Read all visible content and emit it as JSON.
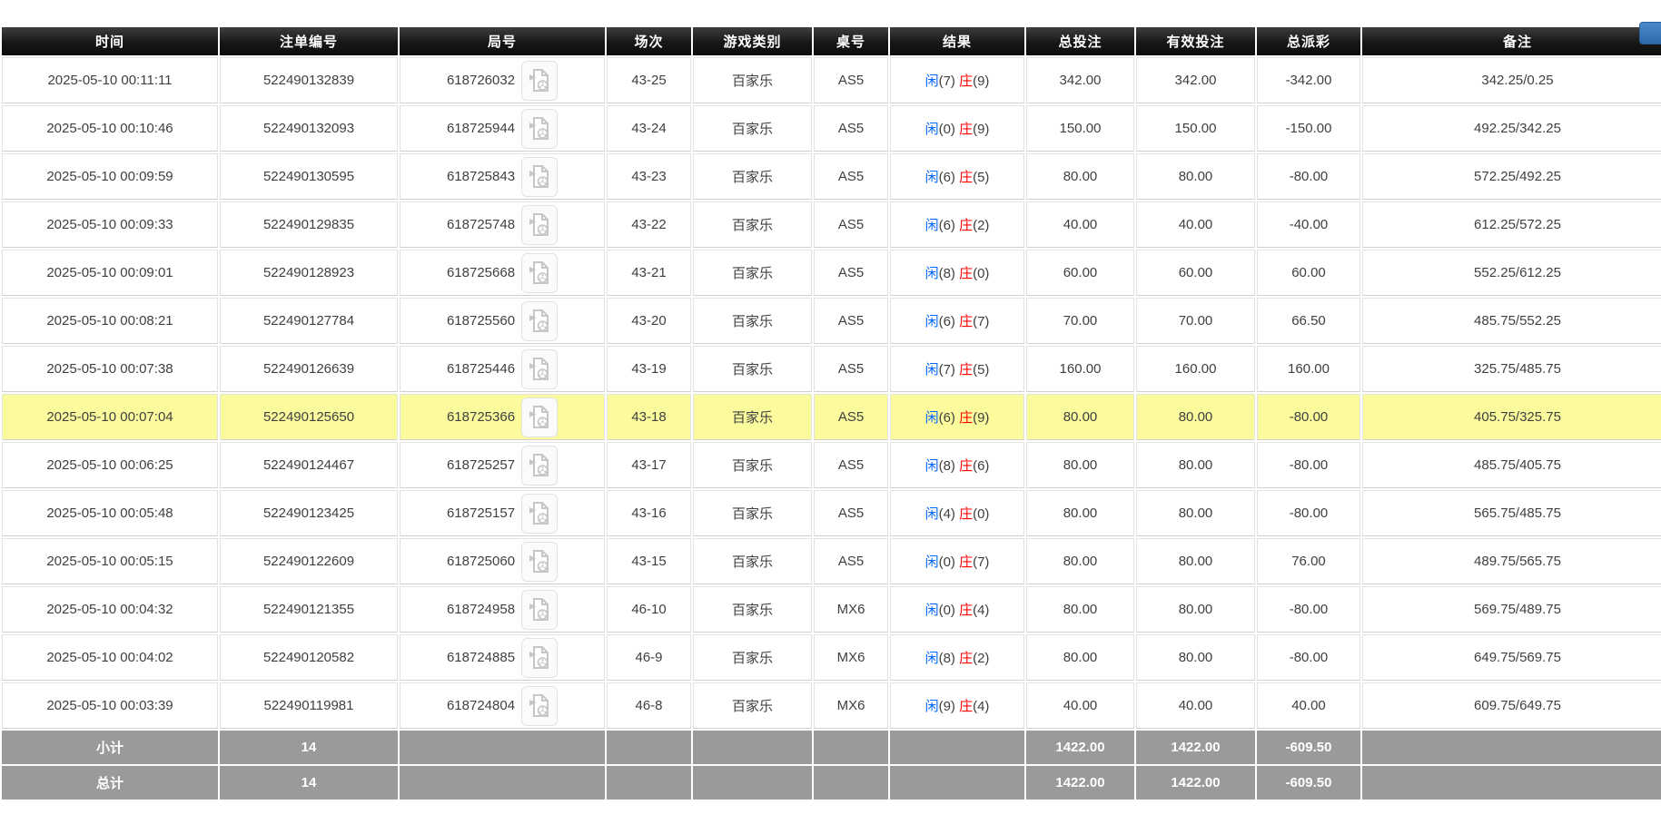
{
  "corner_button": {
    "color": "#3a7abf"
  },
  "colors": {
    "player_blue": "#0066ff",
    "banker_red": "#ff0000",
    "negative_red": "#ff0000",
    "highlight_yellow": "#fbfb9d",
    "header_bg": "#161616",
    "summary_gray": "#9a9a9a"
  },
  "table": {
    "columns": [
      {
        "key": "time",
        "label": "时间"
      },
      {
        "key": "bet-id",
        "label": "注单编号"
      },
      {
        "key": "round-no",
        "label": "局号"
      },
      {
        "key": "session",
        "label": "场次"
      },
      {
        "key": "game-type",
        "label": "游戏类别"
      },
      {
        "key": "table-no",
        "label": "桌号"
      },
      {
        "key": "result",
        "label": "结果"
      },
      {
        "key": "total-bet",
        "label": "总投注"
      },
      {
        "key": "valid-bet",
        "label": "有效投注"
      },
      {
        "key": "total-payout",
        "label": "总派彩"
      },
      {
        "key": "remark",
        "label": "备注"
      }
    ],
    "rows": [
      {
        "time": "2025-05-10 00:11:11",
        "bet_id": "522490132839",
        "round_no": "618726032",
        "session": "43-25",
        "game_type": "百家乐",
        "table_no": "AS5",
        "result": {
          "p": "闲",
          "pv": "(7)",
          "b": "庄",
          "bv": "(9)"
        },
        "total_bet": "342.00",
        "valid_bet": "342.00",
        "payout": "-342.00",
        "remark": "342.25/0.25",
        "highlighted": false
      },
      {
        "time": "2025-05-10 00:10:46",
        "bet_id": "522490132093",
        "round_no": "618725944",
        "session": "43-24",
        "game_type": "百家乐",
        "table_no": "AS5",
        "result": {
          "p": "闲",
          "pv": "(0)",
          "b": "庄",
          "bv": "(9)"
        },
        "total_bet": "150.00",
        "valid_bet": "150.00",
        "payout": "-150.00",
        "remark": "492.25/342.25",
        "highlighted": false
      },
      {
        "time": "2025-05-10 00:09:59",
        "bet_id": "522490130595",
        "round_no": "618725843",
        "session": "43-23",
        "game_type": "百家乐",
        "table_no": "AS5",
        "result": {
          "p": "闲",
          "pv": "(6)",
          "b": "庄",
          "bv": "(5)"
        },
        "total_bet": "80.00",
        "valid_bet": "80.00",
        "payout": "-80.00",
        "remark": "572.25/492.25",
        "highlighted": false
      },
      {
        "time": "2025-05-10 00:09:33",
        "bet_id": "522490129835",
        "round_no": "618725748",
        "session": "43-22",
        "game_type": "百家乐",
        "table_no": "AS5",
        "result": {
          "p": "闲",
          "pv": "(6)",
          "b": "庄",
          "bv": "(2)"
        },
        "total_bet": "40.00",
        "valid_bet": "40.00",
        "payout": "-40.00",
        "remark": "612.25/572.25",
        "highlighted": false
      },
      {
        "time": "2025-05-10 00:09:01",
        "bet_id": "522490128923",
        "round_no": "618725668",
        "session": "43-21",
        "game_type": "百家乐",
        "table_no": "AS5",
        "result": {
          "p": "闲",
          "pv": "(8)",
          "b": "庄",
          "bv": "(0)"
        },
        "total_bet": "60.00",
        "valid_bet": "60.00",
        "payout": "60.00",
        "remark": "552.25/612.25",
        "highlighted": false
      },
      {
        "time": "2025-05-10 00:08:21",
        "bet_id": "522490127784",
        "round_no": "618725560",
        "session": "43-20",
        "game_type": "百家乐",
        "table_no": "AS5",
        "result": {
          "p": "闲",
          "pv": "(6)",
          "b": "庄",
          "bv": "(7)"
        },
        "total_bet": "70.00",
        "valid_bet": "70.00",
        "payout": "66.50",
        "remark": "485.75/552.25",
        "highlighted": false
      },
      {
        "time": "2025-05-10 00:07:38",
        "bet_id": "522490126639",
        "round_no": "618725446",
        "session": "43-19",
        "game_type": "百家乐",
        "table_no": "AS5",
        "result": {
          "p": "闲",
          "pv": "(7)",
          "b": "庄",
          "bv": "(5)"
        },
        "total_bet": "160.00",
        "valid_bet": "160.00",
        "payout": "160.00",
        "remark": "325.75/485.75",
        "highlighted": false
      },
      {
        "time": "2025-05-10 00:07:04",
        "bet_id": "522490125650",
        "round_no": "618725366",
        "session": "43-18",
        "game_type": "百家乐",
        "table_no": "AS5",
        "result": {
          "p": "闲",
          "pv": "(6)",
          "b": "庄",
          "bv": "(9)"
        },
        "total_bet": "80.00",
        "valid_bet": "80.00",
        "payout": "-80.00",
        "remark": "405.75/325.75",
        "highlighted": true
      },
      {
        "time": "2025-05-10 00:06:25",
        "bet_id": "522490124467",
        "round_no": "618725257",
        "session": "43-17",
        "game_type": "百家乐",
        "table_no": "AS5",
        "result": {
          "p": "闲",
          "pv": "(8)",
          "b": "庄",
          "bv": "(6)"
        },
        "total_bet": "80.00",
        "valid_bet": "80.00",
        "payout": "-80.00",
        "remark": "485.75/405.75",
        "highlighted": false
      },
      {
        "time": "2025-05-10 00:05:48",
        "bet_id": "522490123425",
        "round_no": "618725157",
        "session": "43-16",
        "game_type": "百家乐",
        "table_no": "AS5",
        "result": {
          "p": "闲",
          "pv": "(4)",
          "b": "庄",
          "bv": "(0)"
        },
        "total_bet": "80.00",
        "valid_bet": "80.00",
        "payout": "-80.00",
        "remark": "565.75/485.75",
        "highlighted": false
      },
      {
        "time": "2025-05-10 00:05:15",
        "bet_id": "522490122609",
        "round_no": "618725060",
        "session": "43-15",
        "game_type": "百家乐",
        "table_no": "AS5",
        "result": {
          "p": "闲",
          "pv": "(0)",
          "b": "庄",
          "bv": "(7)"
        },
        "total_bet": "80.00",
        "valid_bet": "80.00",
        "payout": "76.00",
        "remark": "489.75/565.75",
        "highlighted": false
      },
      {
        "time": "2025-05-10 00:04:32",
        "bet_id": "522490121355",
        "round_no": "618724958",
        "session": "46-10",
        "game_type": "百家乐",
        "table_no": "MX6",
        "result": {
          "p": "闲",
          "pv": "(0)",
          "b": "庄",
          "bv": "(4)"
        },
        "total_bet": "80.00",
        "valid_bet": "80.00",
        "payout": "-80.00",
        "remark": "569.75/489.75",
        "highlighted": false
      },
      {
        "time": "2025-05-10 00:04:02",
        "bet_id": "522490120582",
        "round_no": "618724885",
        "session": "46-9",
        "game_type": "百家乐",
        "table_no": "MX6",
        "result": {
          "p": "闲",
          "pv": "(8)",
          "b": "庄",
          "bv": "(2)"
        },
        "total_bet": "80.00",
        "valid_bet": "80.00",
        "payout": "-80.00",
        "remark": "649.75/569.75",
        "highlighted": false
      },
      {
        "time": "2025-05-10 00:03:39",
        "bet_id": "522490119981",
        "round_no": "618724804",
        "session": "46-8",
        "game_type": "百家乐",
        "table_no": "MX6",
        "result": {
          "p": "闲",
          "pv": "(9)",
          "b": "庄",
          "bv": "(4)"
        },
        "total_bet": "40.00",
        "valid_bet": "40.00",
        "payout": "40.00",
        "remark": "609.75/649.75",
        "highlighted": false
      }
    ],
    "summary_rows": [
      {
        "label": "小计",
        "count": "14",
        "total_bet": "1422.00",
        "valid_bet": "1422.00",
        "payout": "-609.50"
      },
      {
        "label": "总计",
        "count": "14",
        "total_bet": "1422.00",
        "valid_bet": "1422.00",
        "payout": "-609.50"
      }
    ]
  }
}
